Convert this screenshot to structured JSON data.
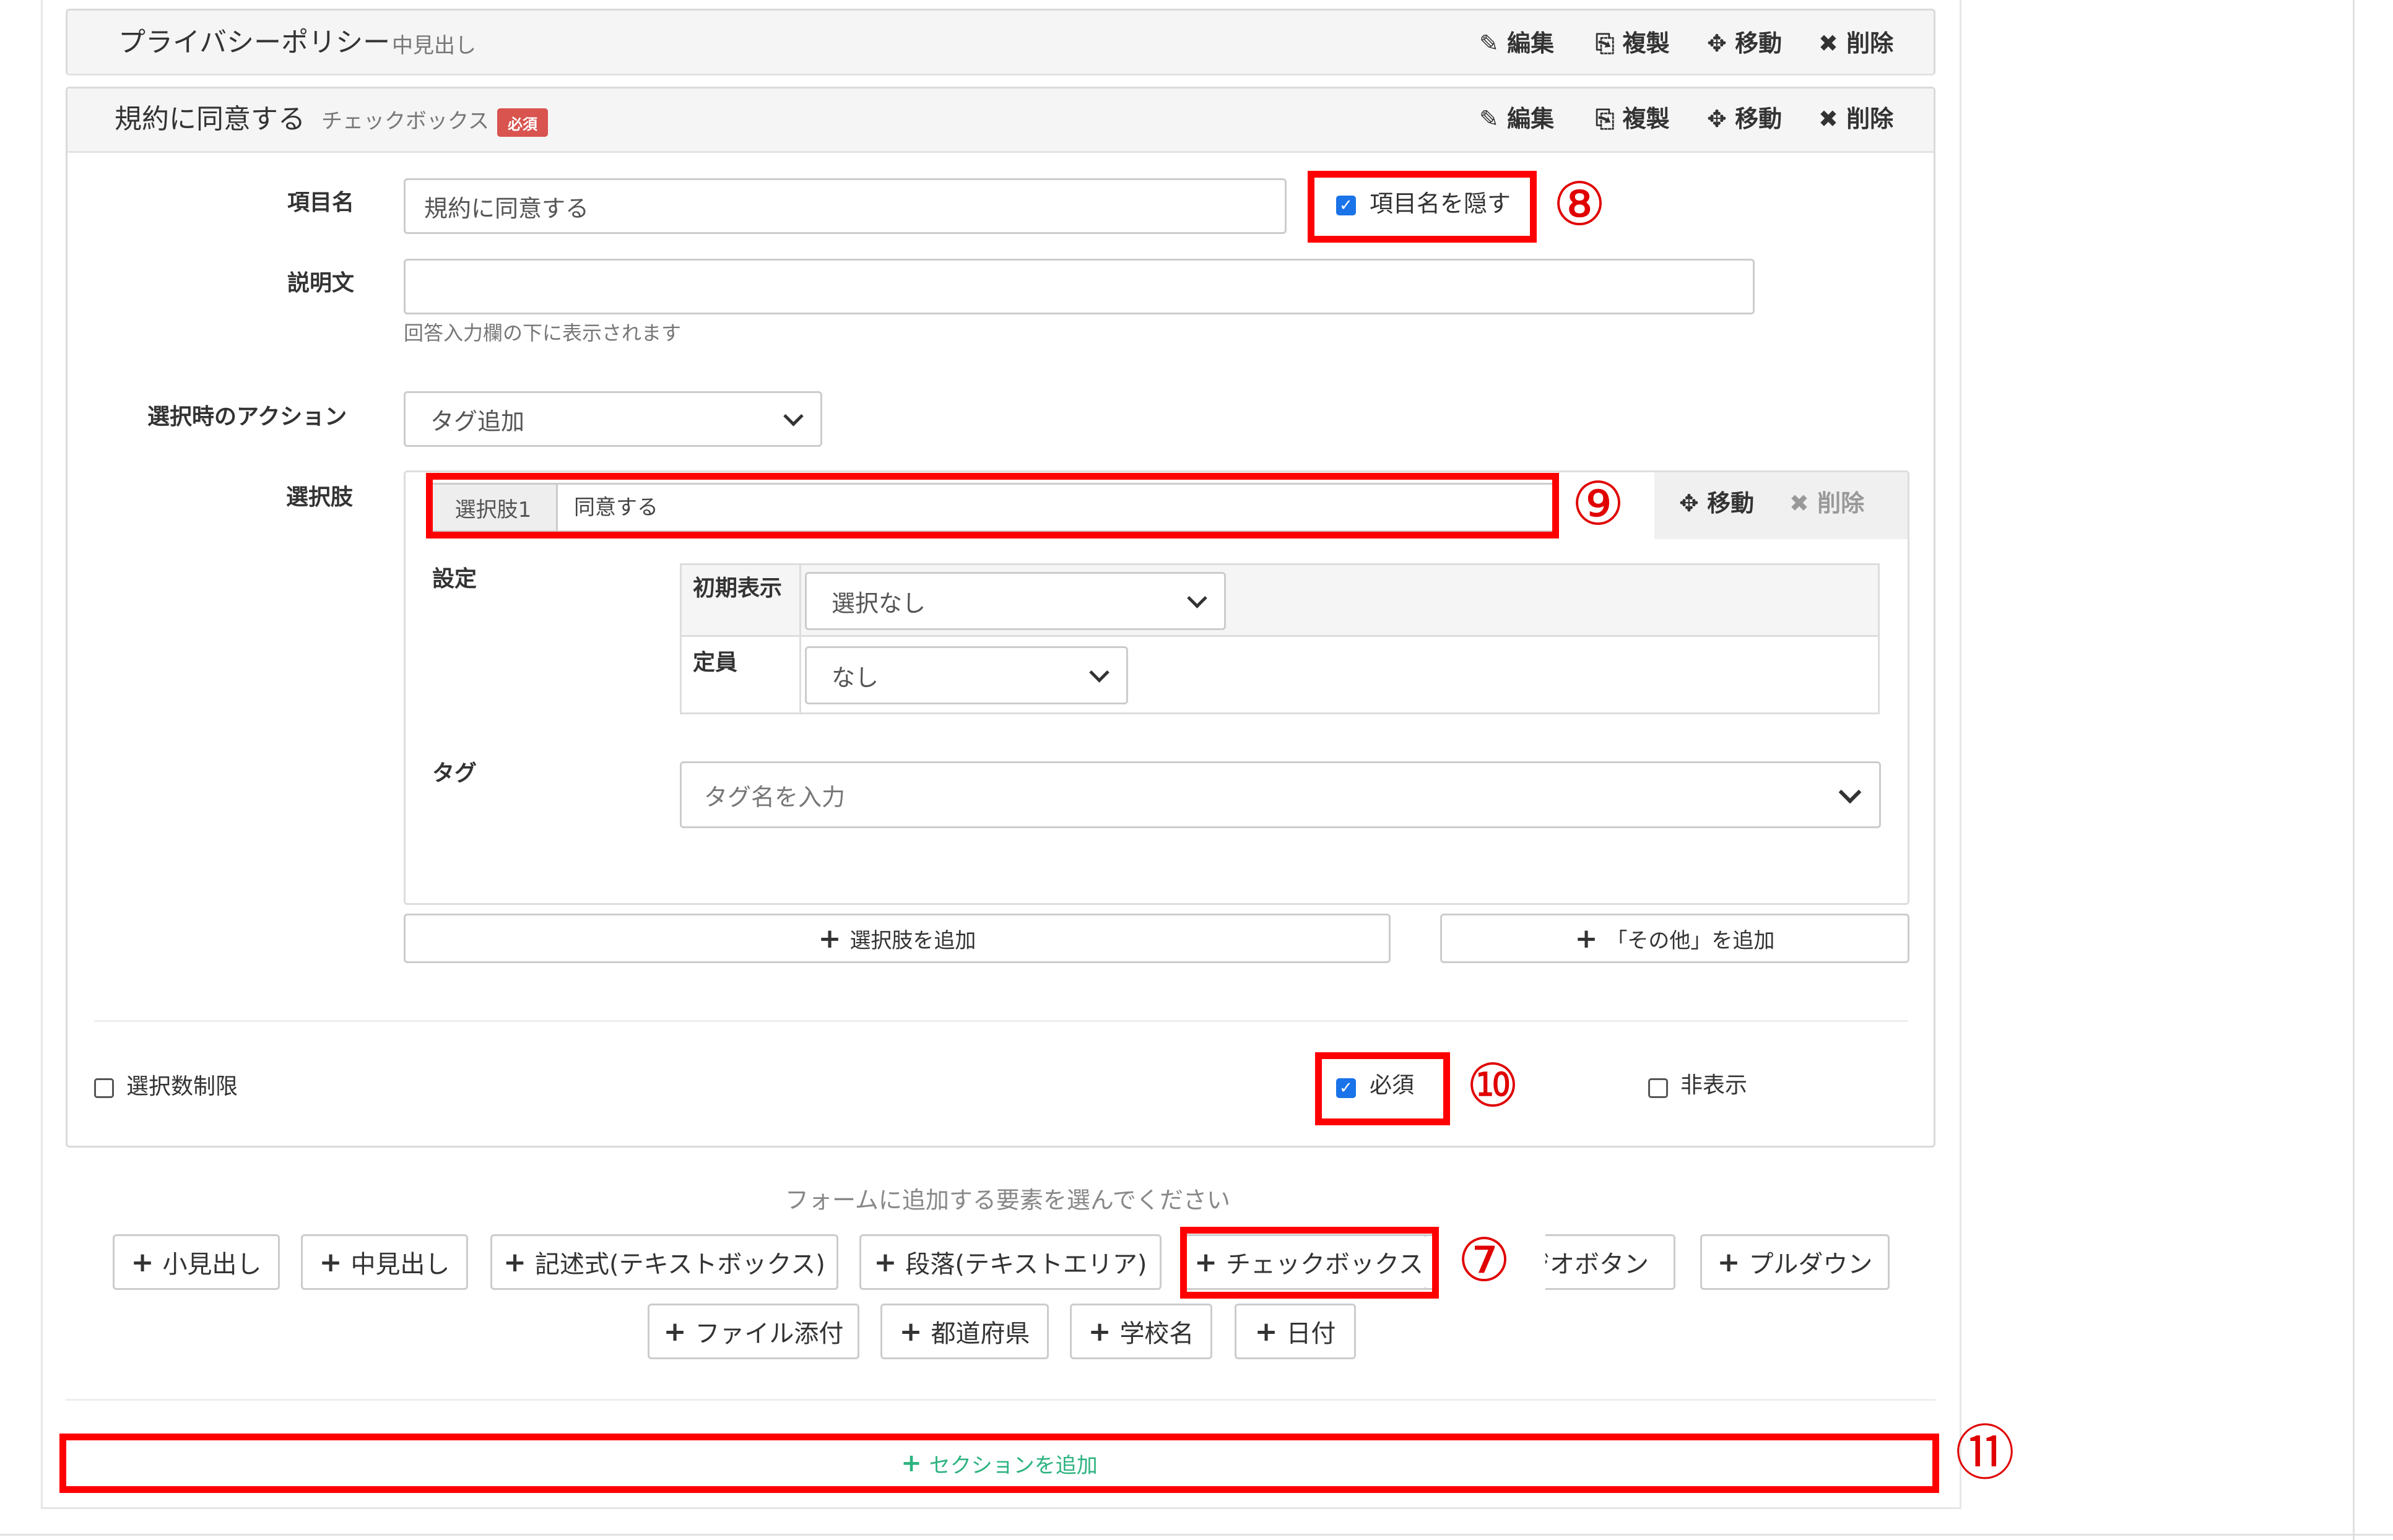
{
  "card1": {
    "title": "プライバシーポリシー",
    "subtitle": "中見出し",
    "actions": [
      "編集",
      "複製",
      "移動",
      "削除"
    ]
  },
  "card2": {
    "title": "規約に同意する",
    "subtitle": "チェックボックス",
    "badge": "必須",
    "actions": [
      "編集",
      "複製",
      "移動",
      "削除"
    ]
  },
  "form": {
    "item_name_label": "項目名",
    "item_name_value": "規約に同意する",
    "hide_label": "項目名を隠す",
    "hide_checked": true,
    "description_label": "説明文",
    "description_value": "",
    "description_help": "回答入力欄の下に表示されます",
    "action_label": "選択時のアクション",
    "action_value": "タグ追加",
    "choices_label": "選択肢"
  },
  "choice": {
    "prefix": "選択肢1",
    "value": "同意する",
    "move": "移動",
    "delete": "削除",
    "settings_label": "設定",
    "initial_label": "初期表示",
    "initial_value": "選択なし",
    "capacity_label": "定員",
    "capacity_value": "なし",
    "tag_label": "タグ",
    "tag_placeholder": "タグ名を入力"
  },
  "add_choice_button": "選択肢を追加",
  "add_other_button": "「その他」を追加",
  "footer": {
    "limit_label": "選択数制限",
    "required_label": "必須",
    "required_checked": true,
    "hidden_label": "非表示"
  },
  "palette": {
    "prompt": "フォームに追加する要素を選んでください",
    "row1": [
      "小見出し",
      "中見出し",
      "記述式(テキストボックス)",
      "段落(テキストエリア)",
      "チェックボックス",
      "ジオボタン",
      "プルダウン"
    ],
    "row2": [
      "ファイル添付",
      "都道府県",
      "学校名",
      "日付"
    ]
  },
  "add_section": "セクションを追加",
  "annotations": [
    "⑦",
    "⑧",
    "⑨",
    "⑩",
    "⑪"
  ],
  "colors": {
    "highlight": "#ff0000",
    "section_add": "#2db37f",
    "checkbox": "#1a73e8",
    "badge": "#d9534f"
  }
}
